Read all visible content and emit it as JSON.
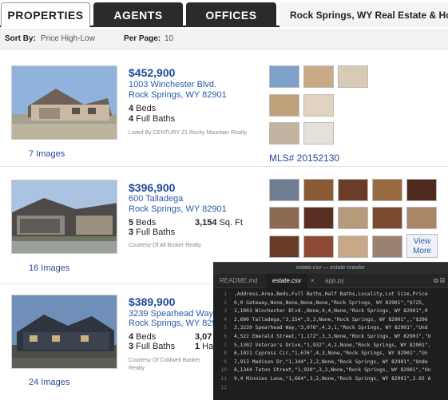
{
  "tabs": {
    "properties": "PROPERTIES",
    "agents": "AGENTS",
    "offices": "OFFICES",
    "site_title": "Rock Springs, WY Real Estate & Homes fo"
  },
  "sortbar": {
    "sort_label": "Sort By:",
    "sort_value": "Price High-Low",
    "per_page_label": "Per Page:",
    "per_page_value": "10"
  },
  "listings": [
    {
      "price": "$452,900",
      "street": "1003 Winchester Blvd.",
      "city": "Rock Springs, WY 82901",
      "beds_num": "4",
      "beds_label": " Beds",
      "baths_num": "4",
      "baths_label": " Full Baths",
      "broker": "Listed By CENTURY 21 Rocky Mountain Realty",
      "images": "7 Images",
      "mls": "MLS# 20152130"
    },
    {
      "price": "$396,900",
      "street": "600 Talladega",
      "city": "Rock Springs, WY 82901",
      "beds_num": "5",
      "beds_label": " Beds",
      "baths_num": "3",
      "baths_label": " Full Baths",
      "sqft_num": "3,154",
      "sqft_label": " Sq. Ft",
      "broker": "Courtesy Of All Broker Realty",
      "images": "16 Images",
      "view_more": "View More"
    },
    {
      "price": "$389,900",
      "street": "3239 Spearhead Way",
      "city": "Rock Springs, WY 82901",
      "beds_num": "4",
      "beds_label": " Beds",
      "baths_num": "3",
      "baths_label": " Full Baths",
      "extra_num": "3,07",
      "half_num": "1",
      "half_label": " Ha",
      "broker_line1": "Courtesy Of Coldwell Banker",
      "broker_line2": "Realty",
      "images": "24 Images"
    }
  ],
  "editor": {
    "window_title": "estate.csv — estate-crawler",
    "tabs": [
      "README.md",
      "estate.csv",
      "app.py"
    ],
    "lines": [
      ",Address,Area,Beds,Full Baths,Half Baths,Locality,Lot Size,Price",
      "0,0 Gateway,None,None,None,None,\"Rock Springs, WY 82901\",\"$725,",
      "1,1003 Winchester Blvd.,None,4,4,None,\"Rock Springs, WY 82901\",0",
      "2,600 Talladega,\"3,154\",5,3,None,\"Rock Springs, WY 82901\",,\"$396",
      "3,3239 Spearhead Way,\"3,076\",4,3,1,\"Rock Springs, WY 82901\",\"Und",
      "4,522 Emerald Street,\"1,172\",3,3,None,\"Rock Springs, WY 82901\",\"U",
      "5,1302 Veteran's Drive,\"1,932\",4,2,None,\"Rock Springs, WY 82901\",",
      "6,1021 Cypress Cir,\"1,676\",4,3,None,\"Rock Springs, WY 82901\",\"Un",
      "7,913 Madison Dr,\"1,344\",3,2,None,\"Rock Springs, WY 82901\",\"Unde",
      "8,1344 Teton Street,\"1,920\",3,2,None,\"Rock Springs, WY 82901\",\"Un",
      "9,4 Minnies Lane,\"1,664\",3,2,None,\"Rock Springs, WY 82901\",2.02 A",
      ""
    ]
  },
  "colors": {
    "price": "#1f4a9e",
    "link": "#2a5aa8",
    "tab_dark": "#2b2b2b",
    "editor_bg": "#1e1e1e"
  }
}
